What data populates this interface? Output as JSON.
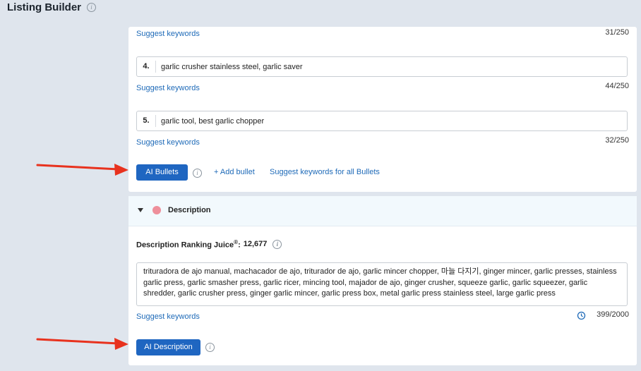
{
  "header": {
    "title": "Listing Builder"
  },
  "bullets": {
    "items": [
      {
        "number": "",
        "value": "",
        "suggest_label": "Suggest keywords",
        "count": "31/250"
      },
      {
        "number": "4.",
        "value": "garlic crusher stainless steel, garlic saver",
        "suggest_label": "Suggest keywords",
        "count": "44/250"
      },
      {
        "number": "5.",
        "value": "garlic tool, best garlic chopper",
        "suggest_label": "Suggest keywords",
        "count": "32/250"
      }
    ],
    "ai_button": "AI Bullets",
    "add_bullet": "+ Add bullet",
    "suggest_all": "Suggest keywords for all Bullets"
  },
  "description": {
    "section_title": "Description",
    "juice_label": "Description Ranking Juice",
    "juice_mark": "®",
    "juice_suffix": ":",
    "juice_value": "12,677",
    "text": "trituradora de ajo manual, machacador de ajo, triturador de ajo, garlic mincer chopper, 마늘 다지기, ginger mincer, garlic presses, stainless garlic press, garlic smasher press, garlic ricer, mincing tool, majador de ajo, ginger crusher, squeeze garlic, garlic squeezer, garlic shredder, garlic crusher press, ginger garlic mincer, garlic press box, metal garlic press stainless steel, large garlic press",
    "suggest_label": "Suggest keywords",
    "count": "399/2000",
    "ai_button": "AI Description"
  },
  "colors": {
    "accent": "#1f66c1",
    "link": "#1e6ab8",
    "section_dot": "#ee8f9b",
    "arrow": "#e8321e"
  }
}
